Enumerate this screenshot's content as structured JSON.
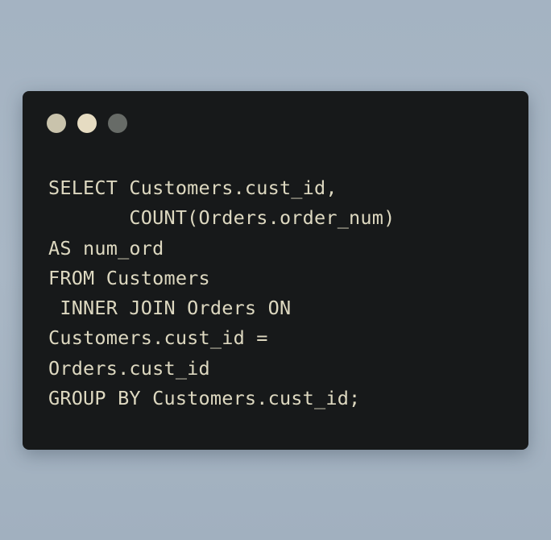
{
  "window": {
    "controls": [
      {
        "name": "close",
        "color": "#c9c3ac"
      },
      {
        "name": "minimize",
        "color": "#e6dcc2"
      },
      {
        "name": "maximize",
        "color": "#676b67"
      }
    ]
  },
  "code": {
    "lines": [
      "SELECT Customers.cust_id,",
      "       COUNT(Orders.order_num)",
      "AS num_ord",
      "FROM Customers",
      " INNER JOIN Orders ON",
      "Customers.cust_id =",
      "Orders.cust_id",
      "GROUP BY Customers.cust_id;"
    ]
  },
  "colors": {
    "window_background": "#17191a",
    "code_text": "#ddd8c0",
    "page_background": "#a6b4c3"
  }
}
